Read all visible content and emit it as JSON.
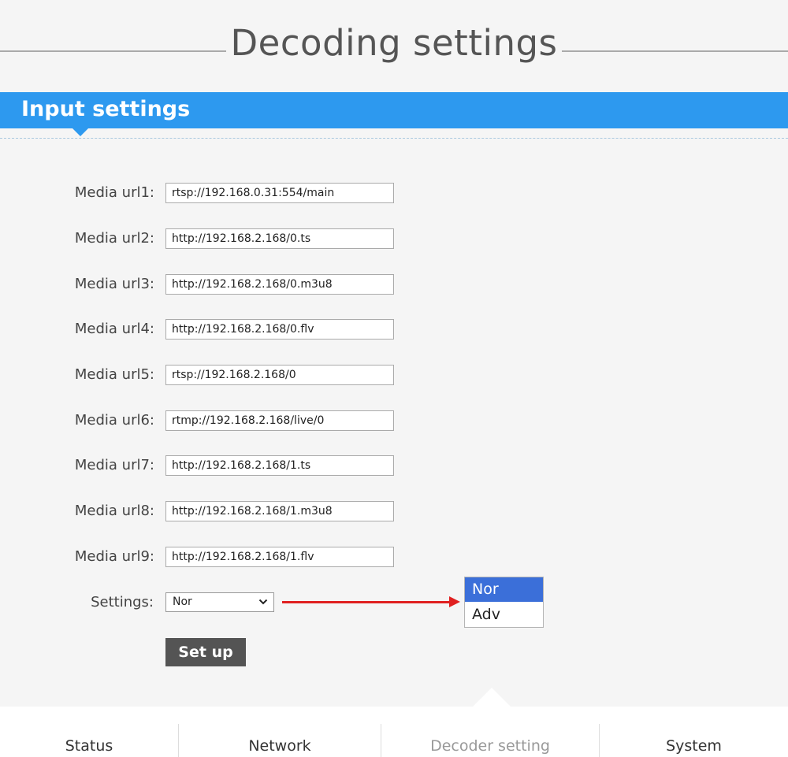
{
  "header": {
    "title": "Decoding settings"
  },
  "section": {
    "title": "Input settings"
  },
  "media_urls": [
    {
      "label": "Media url1:",
      "value": "rtsp://192.168.0.31:554/main"
    },
    {
      "label": "Media url2:",
      "value": "http://192.168.2.168/0.ts"
    },
    {
      "label": "Media url3:",
      "value": "http://192.168.2.168/0.m3u8"
    },
    {
      "label": "Media url4:",
      "value": "http://192.168.2.168/0.flv"
    },
    {
      "label": "Media url5:",
      "value": "rtsp://192.168.2.168/0"
    },
    {
      "label": "Media url6:",
      "value": "rtmp://192.168.2.168/live/0"
    },
    {
      "label": "Media url7:",
      "value": "http://192.168.2.168/1.ts"
    },
    {
      "label": "Media url8:",
      "value": "http://192.168.2.168/1.m3u8"
    },
    {
      "label": "Media url9:",
      "value": "http://192.168.2.168/1.flv"
    }
  ],
  "settings": {
    "label": "Settings:",
    "selected": "Nor",
    "options": [
      "Nor",
      "Adv"
    ]
  },
  "setup_button": {
    "label": "Set up"
  },
  "nav": {
    "tabs": [
      {
        "label": "Status"
      },
      {
        "label": "Network"
      },
      {
        "label": "Decoder setting"
      },
      {
        "label": "System"
      }
    ],
    "active": "Decoder setting"
  },
  "colors": {
    "accent": "#2d99ef",
    "arrow": "#e02020",
    "option_highlight": "#3b6fd9",
    "button": "#545454"
  },
  "icons": {
    "select_chevron": "chevron-down-icon"
  }
}
